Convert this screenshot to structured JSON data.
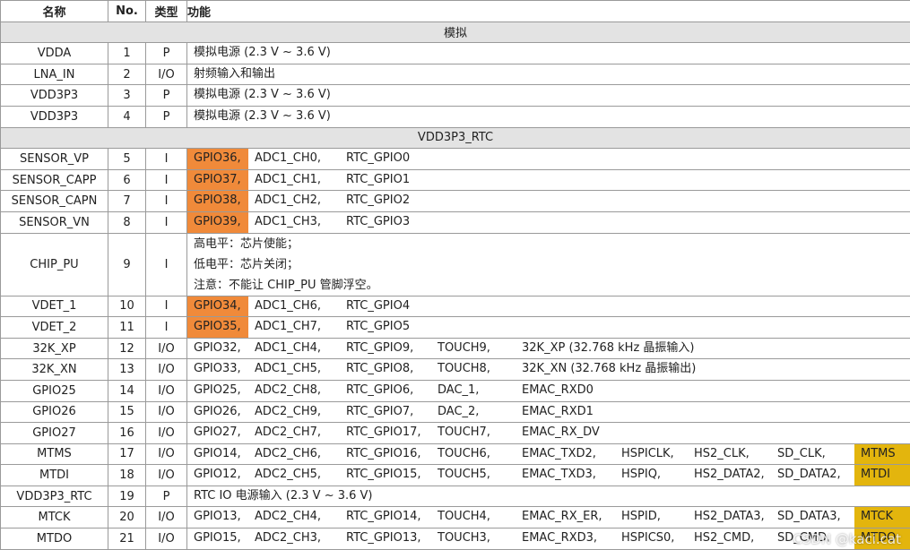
{
  "header": {
    "name": "名称",
    "no": "No.",
    "type": "类型",
    "func": "功能"
  },
  "rows": [
    {
      "section": "模拟"
    },
    {
      "name": "VDDA",
      "no": "1",
      "type": "P",
      "func": [
        {
          "t": "模拟电源 (2.3 V ~ 3.6 V)"
        }
      ]
    },
    {
      "name": "LNA_IN",
      "no": "2",
      "type": "I/O",
      "func": [
        {
          "t": "射频输入和输出"
        }
      ]
    },
    {
      "name": "VDD3P3",
      "no": "3",
      "type": "P",
      "func": [
        {
          "t": "模拟电源 (2.3 V ~ 3.6 V)"
        }
      ]
    },
    {
      "name": "VDD3P3",
      "no": "4",
      "type": "P",
      "func": [
        {
          "t": "模拟电源 (2.3 V ~ 3.6 V)"
        }
      ]
    },
    {
      "section": "VDD3P3_RTC"
    },
    {
      "name": "SENSOR_VP",
      "no": "5",
      "type": "I",
      "func": [
        {
          "t": "GPIO36,",
          "hl": "orange"
        },
        {
          "t": "ADC1_CH0,"
        },
        {
          "t": "RTC_GPIO0"
        }
      ]
    },
    {
      "name": "SENSOR_CAPP",
      "no": "6",
      "type": "I",
      "func": [
        {
          "t": "GPIO37,",
          "hl": "orange"
        },
        {
          "t": "ADC1_CH1,"
        },
        {
          "t": "RTC_GPIO1"
        }
      ]
    },
    {
      "name": "SENSOR_CAPN",
      "no": "7",
      "type": "I",
      "func": [
        {
          "t": "GPIO38,",
          "hl": "orange"
        },
        {
          "t": "ADC1_CH2,"
        },
        {
          "t": "RTC_GPIO2"
        }
      ]
    },
    {
      "name": "SENSOR_VN",
      "no": "8",
      "type": "I",
      "func": [
        {
          "t": "GPIO39,",
          "hl": "orange"
        },
        {
          "t": "ADC1_CH3,"
        },
        {
          "t": "RTC_GPIO3"
        }
      ]
    },
    {
      "name": "CHIP_PU",
      "no": "9",
      "type": "I",
      "multi": true,
      "lines": [
        "高电平：芯片使能；",
        "低电平：芯片关闭；",
        "注意：不能让 CHIP_PU 管脚浮空。"
      ]
    },
    {
      "name": "VDET_1",
      "no": "10",
      "type": "I",
      "func": [
        {
          "t": "GPIO34,",
          "hl": "orange"
        },
        {
          "t": "ADC1_CH6,"
        },
        {
          "t": "RTC_GPIO4"
        }
      ]
    },
    {
      "name": "VDET_2",
      "no": "11",
      "type": "I",
      "func": [
        {
          "t": "GPIO35,",
          "hl": "orange"
        },
        {
          "t": "ADC1_CH7,"
        },
        {
          "t": "RTC_GPIO5"
        }
      ]
    },
    {
      "name": "32K_XP",
      "no": "12",
      "type": "I/O",
      "func": [
        {
          "t": "GPIO32,"
        },
        {
          "t": "ADC1_CH4,"
        },
        {
          "t": "RTC_GPIO9,"
        },
        {
          "t": "TOUCH9,"
        },
        {
          "t": "32K_XP (32.768 kHz 晶振输入)"
        }
      ]
    },
    {
      "name": "32K_XN",
      "no": "13",
      "type": "I/O",
      "func": [
        {
          "t": "GPIO33,"
        },
        {
          "t": "ADC1_CH5,"
        },
        {
          "t": "RTC_GPIO8,"
        },
        {
          "t": "TOUCH8,"
        },
        {
          "t": "32K_XN (32.768 kHz 晶振输出)"
        }
      ]
    },
    {
      "name": "GPIO25",
      "no": "14",
      "type": "I/O",
      "func": [
        {
          "t": "GPIO25,"
        },
        {
          "t": "ADC2_CH8,"
        },
        {
          "t": "RTC_GPIO6,"
        },
        {
          "t": "DAC_1,"
        },
        {
          "t": "EMAC_RXD0"
        }
      ]
    },
    {
      "name": "GPIO26",
      "no": "15",
      "type": "I/O",
      "func": [
        {
          "t": "GPIO26,"
        },
        {
          "t": "ADC2_CH9,"
        },
        {
          "t": "RTC_GPIO7,"
        },
        {
          "t": "DAC_2,"
        },
        {
          "t": "EMAC_RXD1"
        }
      ]
    },
    {
      "name": "GPIO27",
      "no": "16",
      "type": "I/O",
      "func": [
        {
          "t": "GPIO27,"
        },
        {
          "t": "ADC2_CH7,"
        },
        {
          "t": "RTC_GPIO17,"
        },
        {
          "t": "TOUCH7,"
        },
        {
          "t": "EMAC_RX_DV"
        }
      ]
    },
    {
      "name": "MTMS",
      "no": "17",
      "type": "I/O",
      "func": [
        {
          "t": "GPIO14,"
        },
        {
          "t": "ADC2_CH6,"
        },
        {
          "t": "RTC_GPIO16,"
        },
        {
          "t": "TOUCH6,"
        },
        {
          "t": "EMAC_TXD2,"
        },
        {
          "t": "HSPICLK,"
        },
        {
          "t": "HS2_CLK,"
        },
        {
          "t": "SD_CLK,"
        },
        {
          "t": "MTMS",
          "hl": "yellow"
        }
      ]
    },
    {
      "name": "MTDI",
      "no": "18",
      "type": "I/O",
      "func": [
        {
          "t": "GPIO12,"
        },
        {
          "t": "ADC2_CH5,"
        },
        {
          "t": "RTC_GPIO15,"
        },
        {
          "t": "TOUCH5,"
        },
        {
          "t": "EMAC_TXD3,"
        },
        {
          "t": "HSPIQ,"
        },
        {
          "t": "HS2_DATA2,"
        },
        {
          "t": "SD_DATA2,"
        },
        {
          "t": "MTDI",
          "hl": "yellow"
        }
      ]
    },
    {
      "name": "VDD3P3_RTC",
      "no": "19",
      "type": "P",
      "func": [
        {
          "t": "RTC IO 电源输入 (2.3 V ~ 3.6 V)"
        }
      ]
    },
    {
      "name": "MTCK",
      "no": "20",
      "type": "I/O",
      "func": [
        {
          "t": "GPIO13,"
        },
        {
          "t": "ADC2_CH4,"
        },
        {
          "t": "RTC_GPIO14,"
        },
        {
          "t": "TOUCH4,"
        },
        {
          "t": "EMAC_RX_ER,"
        },
        {
          "t": "HSPID,"
        },
        {
          "t": "HS2_DATA3,"
        },
        {
          "t": "SD_DATA3,"
        },
        {
          "t": "MTCK",
          "hl": "yellow"
        }
      ]
    },
    {
      "name": "MTDO",
      "no": "21",
      "type": "I/O",
      "func": [
        {
          "t": "GPIO15,"
        },
        {
          "t": "ADC2_CH3,"
        },
        {
          "t": "RTC_GPIO13,"
        },
        {
          "t": "TOUCH3,"
        },
        {
          "t": "EMAC_RXD3,"
        },
        {
          "t": "HSPICS0,"
        },
        {
          "t": "HS2_CMD,"
        },
        {
          "t": "SD_CMD,"
        },
        {
          "t": "MTDO",
          "hl": "yellow"
        }
      ]
    }
  ],
  "watermark": "CSDN @kaci.cat"
}
